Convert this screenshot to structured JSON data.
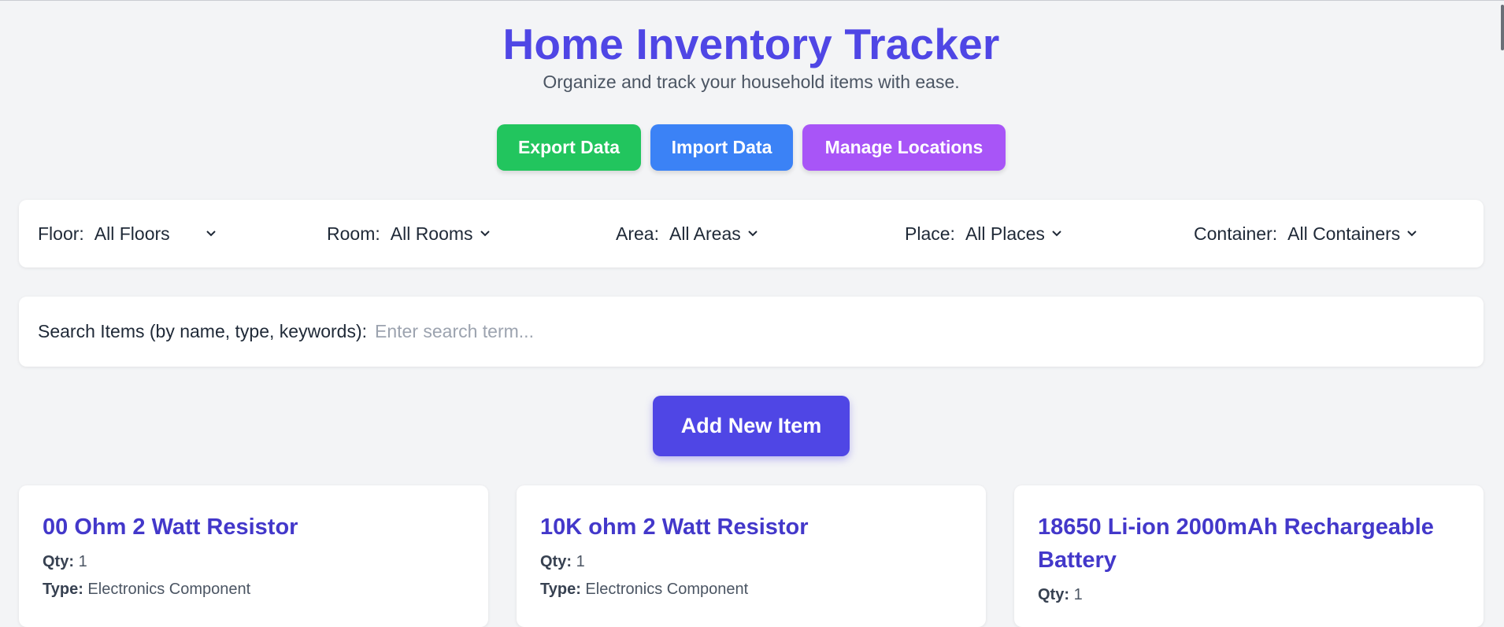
{
  "header": {
    "title": "Home Inventory Tracker",
    "subtitle": "Organize and track your household items with ease."
  },
  "actions": {
    "export_label": "Export Data",
    "import_label": "Import Data",
    "locations_label": "Manage Locations"
  },
  "filters": [
    {
      "label": "Floor:",
      "value": "All Floors"
    },
    {
      "label": "Room:",
      "value": "All Rooms"
    },
    {
      "label": "Area:",
      "value": "All Areas"
    },
    {
      "label": "Place:",
      "value": "All Places"
    },
    {
      "label": "Container:",
      "value": "All Containers"
    }
  ],
  "search": {
    "label": "Search Items (by name, type, keywords):",
    "placeholder": "Enter search term...",
    "value": ""
  },
  "add_item_label": "Add New Item",
  "items": [
    {
      "name": "00 Ohm 2 Watt Resistor",
      "qty_label": "Qty:",
      "qty": "1",
      "type_label": "Type:",
      "type": "Electronics Component"
    },
    {
      "name": "10K ohm 2 Watt Resistor",
      "qty_label": "Qty:",
      "qty": "1",
      "type_label": "Type:",
      "type": "Electronics Component"
    },
    {
      "name": "18650 Li-ion 2000mAh Rechargeable Battery",
      "qty_label": "Qty:",
      "qty": "1"
    }
  ],
  "colors": {
    "accent": "#4f46e5",
    "export": "#22c55e",
    "import": "#3b82f6",
    "locations": "#a855f7",
    "card_title": "#4338ca",
    "background": "#f3f4f6"
  },
  "icons": {
    "dropdown": "chevron-down-icon"
  }
}
